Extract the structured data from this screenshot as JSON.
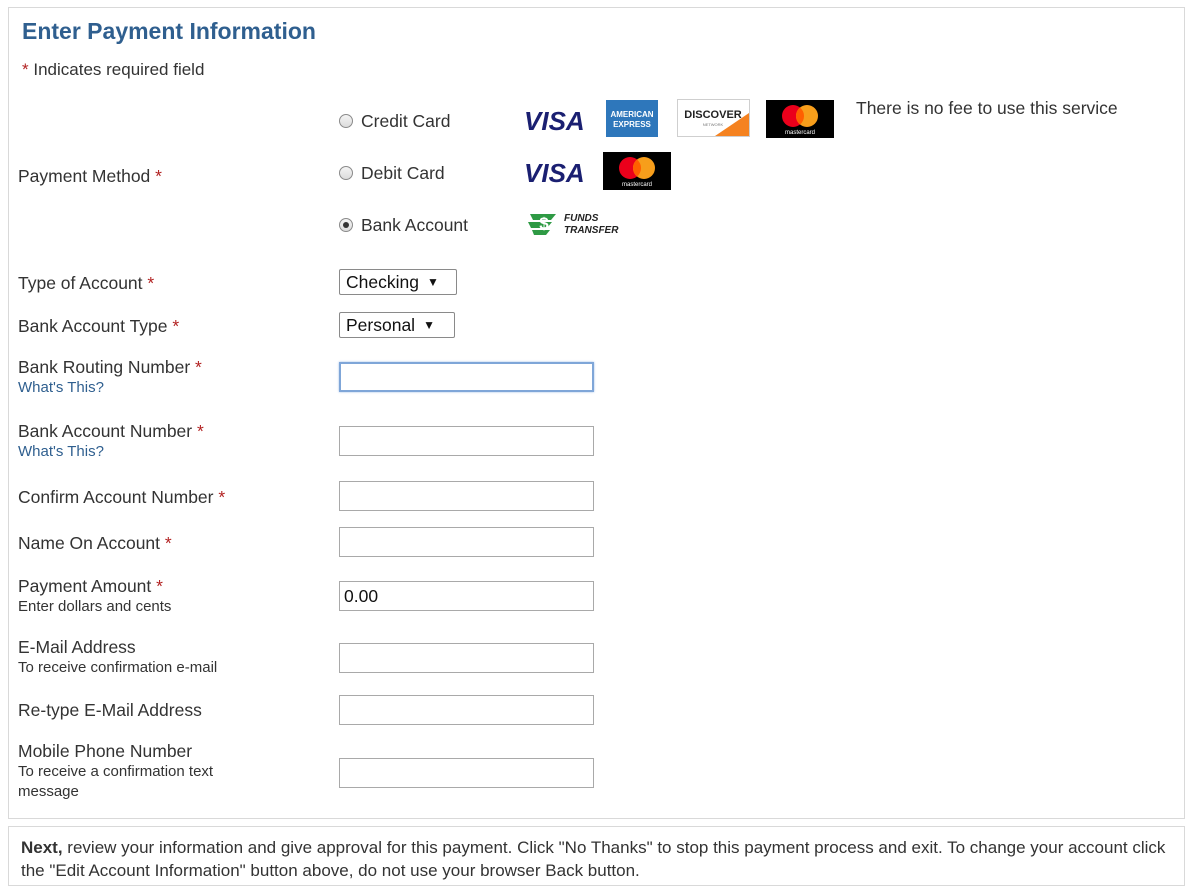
{
  "header": {
    "title": "Enter Payment Information",
    "required_star": "*",
    "required_note": "Indicates required field"
  },
  "payment_method": {
    "label": "Payment Method",
    "options": [
      {
        "label": "Credit Card",
        "selected": false
      },
      {
        "label": "Debit Card",
        "selected": false
      },
      {
        "label": "Bank Account",
        "selected": true
      }
    ],
    "fee_note": "There is no fee to use this service",
    "logos": {
      "visa": "VISA",
      "amex_line1": "AMERICAN",
      "amex_line2": "EXPRESS",
      "discover": "DISCOVER",
      "discover_sub": "NETWORK",
      "mastercard": "mastercard",
      "funds_line1": "FUNDS",
      "funds_line2": "TRANSFER"
    }
  },
  "fields": {
    "type_of_account": {
      "label": "Type of Account",
      "value": "Checking"
    },
    "bank_account_type": {
      "label": "Bank Account Type",
      "value": "Personal"
    },
    "routing": {
      "label": "Bank Routing Number",
      "help": "What's This?",
      "value": ""
    },
    "account_number": {
      "label": "Bank Account Number",
      "help": "What's This?",
      "value": ""
    },
    "confirm_account": {
      "label": "Confirm Account Number",
      "value": ""
    },
    "name_on_account": {
      "label": "Name On Account",
      "value": ""
    },
    "payment_amount": {
      "label": "Payment Amount",
      "sub": "Enter dollars and cents",
      "value": "0.00"
    },
    "email": {
      "label": "E-Mail Address",
      "sub": "To receive confirmation e-mail",
      "value": ""
    },
    "retype_email": {
      "label": "Re-type E-Mail Address",
      "value": ""
    },
    "mobile": {
      "label": "Mobile Phone Number",
      "sub": "To receive a confirmation text message",
      "value": ""
    }
  },
  "footer": {
    "next_bold": "Next,",
    "next_text": " review your information and give approval for this payment. Click \"No Thanks\" to stop this payment process and exit. To change your account click the \"Edit Account Information\" button above, do not use your browser Back button."
  },
  "colors": {
    "title": "#2f5f8f",
    "required": "#b22222",
    "link": "#2f5f8f",
    "visa": "#1a1f71",
    "amex": "#2e77bb",
    "discover_orange": "#f58220",
    "mc_red": "#eb001b",
    "mc_orange": "#f79e1b",
    "funds_green": "#2e9a44"
  }
}
